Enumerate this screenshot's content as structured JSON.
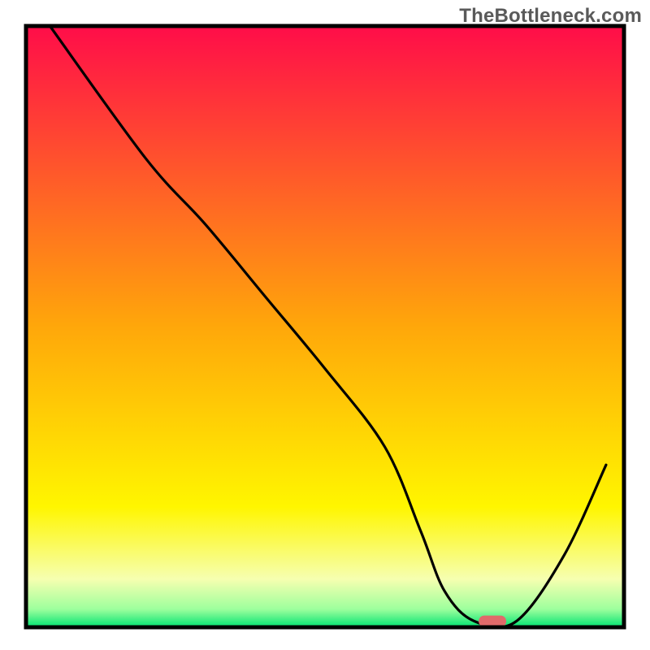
{
  "watermark": "TheBottleneck.com",
  "chart_data": {
    "type": "line",
    "title": "",
    "xlabel": "",
    "ylabel": "",
    "xlim": [
      0,
      100
    ],
    "ylim": [
      0,
      100
    ],
    "x": [
      4,
      20,
      30,
      40,
      50,
      60,
      66,
      70,
      75,
      82,
      90,
      97
    ],
    "values": [
      100,
      78,
      67,
      55,
      43,
      30,
      16,
      6,
      1,
      1,
      12,
      27
    ],
    "optimum_marker": {
      "x": 78,
      "y": 1
    },
    "background_gradient": {
      "stops": [
        {
          "offset": 0.0,
          "color": "#ff0d49"
        },
        {
          "offset": 0.5,
          "color": "#ffa70a"
        },
        {
          "offset": 0.8,
          "color": "#fff600"
        },
        {
          "offset": 0.92,
          "color": "#f6ffb0"
        },
        {
          "offset": 0.97,
          "color": "#9dff9d"
        },
        {
          "offset": 1.0,
          "color": "#00e371"
        }
      ]
    },
    "frame_color": "#000000",
    "line_color": "#000000",
    "marker_color": "#e06a6a"
  }
}
